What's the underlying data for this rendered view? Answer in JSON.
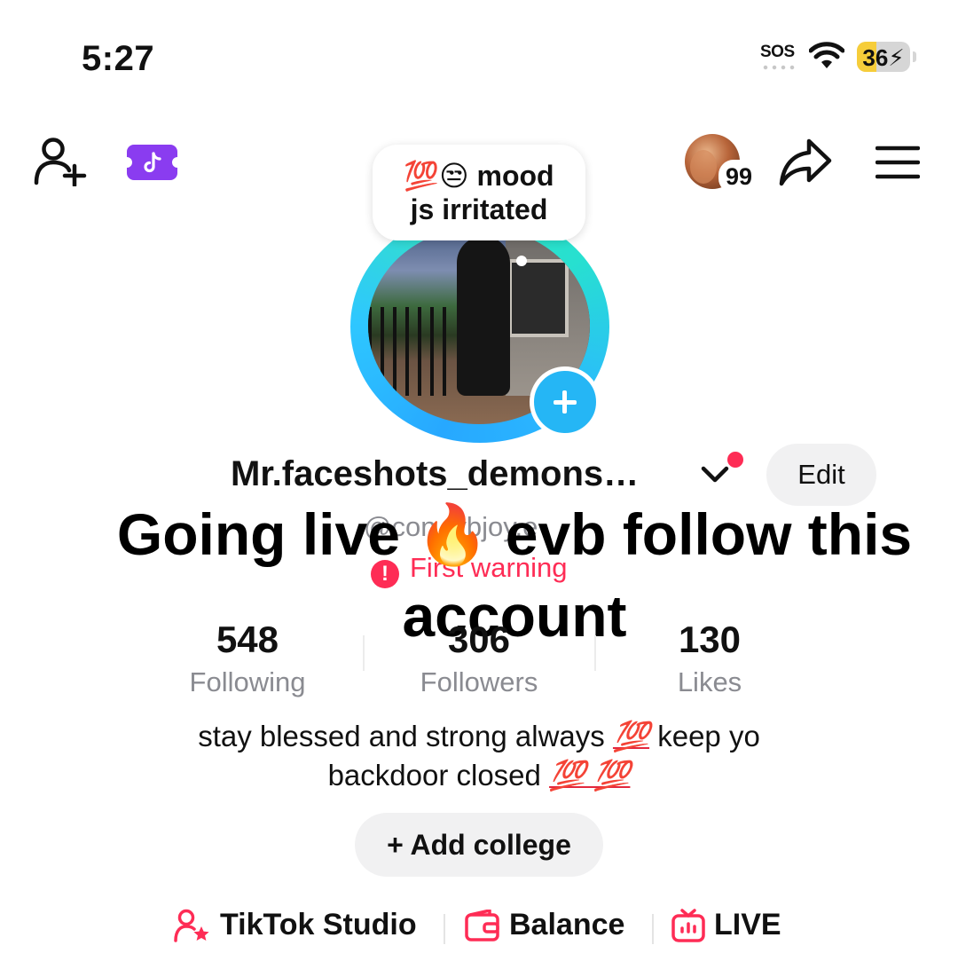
{
  "status_bar": {
    "time": "5:27",
    "sos": "SOS",
    "battery": "36",
    "battery_level_percent": 36,
    "battery_color": "#f6cd3a"
  },
  "top_bar": {
    "add_friend_icon": "add-person-icon",
    "ticket_icon": "tiktok-ticket-icon",
    "story_count": "99",
    "share_icon": "share-arrow-icon",
    "menu_icon": "hamburger-menu-icon"
  },
  "profile": {
    "mood_line1_emoji": "💯😒",
    "mood_line1_text": "mood",
    "mood_line2": "js irritated",
    "username": "Mr.faceshots_demons…",
    "edit_label": "Edit",
    "handle": "@con  rybjoy.e",
    "warning": "First warning",
    "warning_color": "#fe2c55"
  },
  "overlay_text": "Going live 🔥 evb follow this account",
  "stats": [
    {
      "value": "548",
      "label": "Following"
    },
    {
      "value": "306",
      "label": "Followers"
    },
    {
      "value": "130",
      "label": "Likes"
    }
  ],
  "bio": {
    "line1_a": "stay blessed and strong always",
    "line1_emoji": "💯",
    "line1_b": "keep yo",
    "line2_a": "backdoor closed",
    "line2_emoji": "💯 💯"
  },
  "add_college": "+ Add college",
  "tools": [
    {
      "label": "TikTok Studio",
      "icon": "creator-star-icon"
    },
    {
      "label": "Balance",
      "icon": "wallet-icon"
    },
    {
      "label": "LIVE",
      "icon": "live-tv-icon"
    }
  ],
  "accent_color": "#fe2c55"
}
